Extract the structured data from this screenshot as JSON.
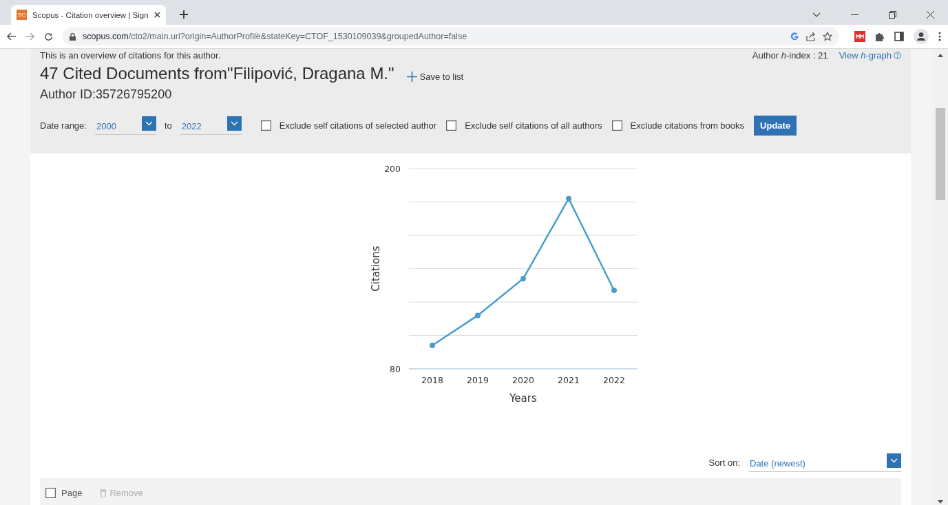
{
  "browser": {
    "tab": {
      "favicon": "SC",
      "title": "Scopus - Citation overview | Sign"
    },
    "url": {
      "host": "scopus.com",
      "path": "/cto2/main.uri?origin=AuthorProfile&stateKey=CTOF_1530109039&groupedAuthor=false"
    }
  },
  "header": {
    "intro": "This is an overview of citations for this author.",
    "h_index": "Author *h*-index : 21",
    "h_graph_link": "View *h*-graph",
    "title": "47 Cited Documents from\"Filipović, Dragana M.\"",
    "save_to_list": "Save to list",
    "author_id": "Author ID:35726795200"
  },
  "filters": {
    "date_range_label": "Date range:",
    "from": "2000",
    "to_label": "to",
    "to": "2022",
    "options": [
      {
        "label": "Exclude self citations of selected author",
        "checked": false
      },
      {
        "label": "Exclude self citations of all authors",
        "checked": false
      },
      {
        "label": "Exclude citations from books",
        "checked": false
      }
    ],
    "update_button": "Update"
  },
  "chart": {
    "chart_data": {
      "type": "line",
      "xlabel": "Years",
      "ylabel": "Citations",
      "categories": [
        "2018",
        "2019",
        "2020",
        "2021",
        "2022"
      ],
      "ylim": [
        80,
        200
      ],
      "yticks": [
        80,
        200
      ],
      "series": [
        {
          "color": "#4a9ccb",
          "marker": "circle",
          "values": [
            94,
            112,
            134,
            182,
            127
          ]
        }
      ]
    }
  },
  "sort": {
    "label": "Sort on:",
    "value": "Date (newest)"
  },
  "toolbar": {
    "page_label": "Page",
    "page_checked": false,
    "remove": "Remove",
    "remove_disabled": true
  }
}
